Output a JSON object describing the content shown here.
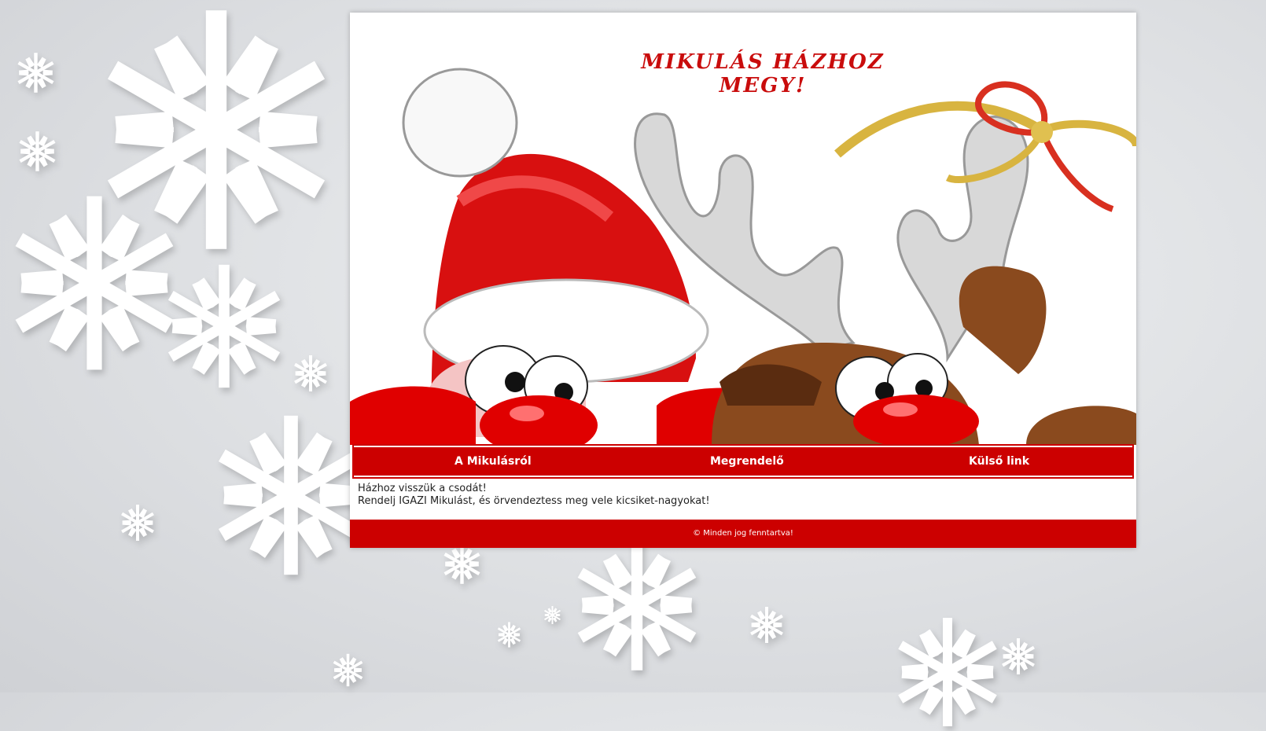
{
  "header": {
    "title": "MIKULÁS HÁZHOZ MEGY!"
  },
  "nav": {
    "items": [
      {
        "label": "A Mikulásról"
      },
      {
        "label": "Megrendelő"
      },
      {
        "label": "Külső link"
      }
    ]
  },
  "content": {
    "line1": "Házhoz visszük a csodát!",
    "line2": "Rendelj IGAZI Mikulást, és örvendeztess meg vele kicsiket-nagyokat!"
  },
  "footer": {
    "text": "© Minden jog fenntartva!"
  },
  "colors": {
    "accent": "#cc0000",
    "title": "#c90c0c",
    "background": "#dcdee1"
  },
  "icons": [
    "snowflake-icon",
    "santa-illustration",
    "reindeer-illustration",
    "gold-bow-icon"
  ]
}
